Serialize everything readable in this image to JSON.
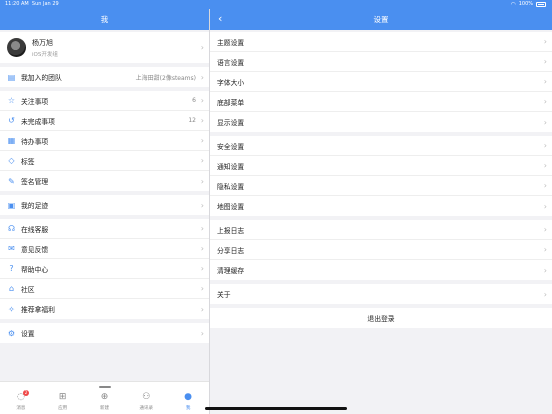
{
  "status": {
    "time": "11:20 AM",
    "date": "Sun Jan 29",
    "battery": "100%"
  },
  "left": {
    "title": "我",
    "profile": {
      "name": "杨万旭",
      "subtitle": "iOS开发组"
    },
    "team": {
      "label": "我加入的团队",
      "value": "上海田甜(2像steams)"
    },
    "group1": [
      {
        "icon": "star-icon",
        "glyph": "☆",
        "label": "关注事项",
        "value": "6"
      },
      {
        "icon": "history-icon",
        "glyph": "↺",
        "label": "未完成事项",
        "value": "12"
      },
      {
        "icon": "calendar-icon",
        "glyph": "▦",
        "label": "待办事项",
        "value": ""
      },
      {
        "icon": "tag-icon",
        "glyph": "◇",
        "label": "标签",
        "value": ""
      },
      {
        "icon": "pen-icon",
        "glyph": "✎",
        "label": "签名管理",
        "value": ""
      }
    ],
    "footprint": {
      "icon": "footprint-icon",
      "glyph": "▣",
      "label": "我的足迹"
    },
    "group2": [
      {
        "icon": "headset-icon",
        "glyph": "☊",
        "label": "在线客服"
      },
      {
        "icon": "feedback-icon",
        "glyph": "✉",
        "label": "意见反馈"
      },
      {
        "icon": "help-icon",
        "glyph": "?",
        "label": "帮助中心"
      },
      {
        "icon": "community-icon",
        "glyph": "⌂",
        "label": "社区"
      },
      {
        "icon": "gift-icon",
        "glyph": "✧",
        "label": "推荐拿福利"
      }
    ],
    "settings": {
      "icon": "settings-icon",
      "glyph": "⚙",
      "label": "设置"
    }
  },
  "right": {
    "title": "设置",
    "group1": [
      "主题设置",
      "语言设置",
      "字体大小",
      "底部菜单",
      "显示设置"
    ],
    "group2": [
      "安全设置",
      "通知设置",
      "隐私设置",
      "地图设置"
    ],
    "group3": [
      "上报日志",
      "分享日志",
      "清理缓存"
    ],
    "group4": [
      "关于"
    ],
    "logout": "退出登录"
  },
  "tabs": [
    {
      "icon": "message-icon",
      "glyph": "◌",
      "label": "消息",
      "badge": "2",
      "active": false
    },
    {
      "icon": "apps-icon",
      "glyph": "⊞",
      "label": "应用",
      "badge": "",
      "active": false
    },
    {
      "icon": "add-icon",
      "glyph": "⊕",
      "label": "新建",
      "badge": "",
      "active": false
    },
    {
      "icon": "contacts-icon",
      "glyph": "⚇",
      "label": "通讯录",
      "badge": "",
      "active": false
    },
    {
      "icon": "me-icon",
      "glyph": "●",
      "label": "我",
      "badge": "",
      "active": true
    }
  ]
}
